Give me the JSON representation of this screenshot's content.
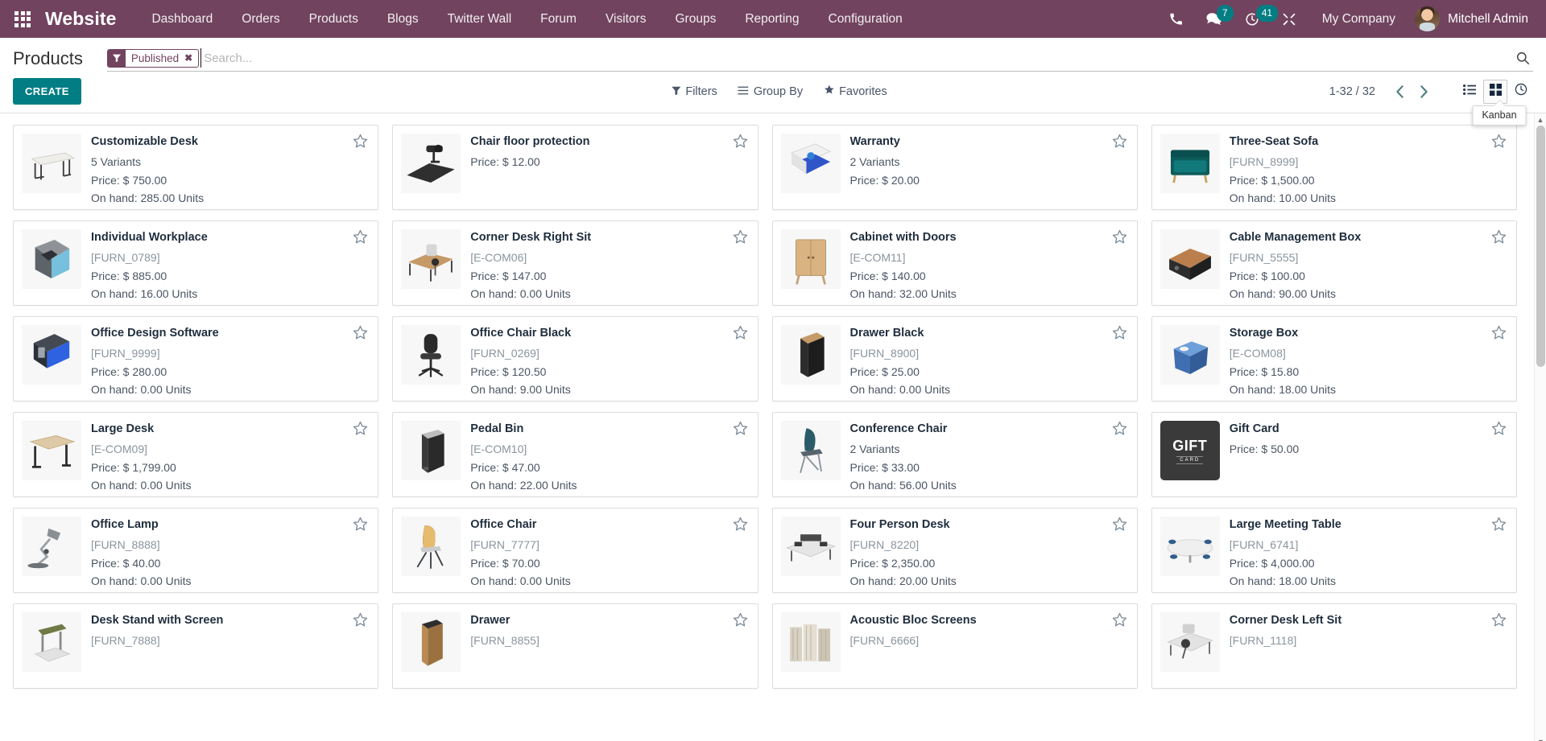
{
  "navbar": {
    "apps_icon": "apps-grid-icon",
    "brand": "Website",
    "menu": [
      {
        "label": "Dashboard"
      },
      {
        "label": "Orders"
      },
      {
        "label": "Products"
      },
      {
        "label": "Blogs"
      },
      {
        "label": "Twitter Wall"
      },
      {
        "label": "Forum"
      },
      {
        "label": "Visitors"
      },
      {
        "label": "Groups"
      },
      {
        "label": "Reporting"
      },
      {
        "label": "Configuration"
      }
    ],
    "icons": [
      {
        "name": "phone-icon",
        "badge": ""
      },
      {
        "name": "messages-icon",
        "badge": "7"
      },
      {
        "name": "activities-clock-icon",
        "badge": "41"
      },
      {
        "name": "debug-tools-icon",
        "badge": ""
      }
    ],
    "company": "My Company",
    "user": "Mitchell Admin",
    "avatar": "user-avatar",
    "bg_color": "#71435f",
    "badge_color": "#017e84"
  },
  "control_panel": {
    "title": "Products",
    "create_label": "CREATE",
    "search": {
      "facet_icon": "filter-funnel-icon",
      "facet_label": "Published",
      "facet_close": "✖",
      "value": "",
      "placeholder": "Search..."
    },
    "dropdowns": [
      {
        "name": "filters",
        "icon": "funnel-icon",
        "label": "Filters"
      },
      {
        "name": "group-by",
        "icon": "bars-icon",
        "label": "Group By"
      },
      {
        "name": "favorites",
        "icon": "star-icon",
        "label": "Favorites"
      }
    ],
    "pager": {
      "count": "1-32 / 32",
      "prev": "‹",
      "next": "›"
    },
    "views": [
      {
        "name": "list-view",
        "icon": "list-icon",
        "active": false
      },
      {
        "name": "kanban-view",
        "icon": "grid-icon",
        "active": true
      },
      {
        "name": "activity-view",
        "icon": "clock-icon",
        "active": false
      }
    ],
    "tooltip": "Kanban"
  },
  "products": [
    {
      "name": "Customizable Desk",
      "sub": "5 Variants",
      "sub_is_code": false,
      "price": "Price: $ 750.00",
      "onhand": "On hand: 285.00 Units",
      "image": "desk-white"
    },
    {
      "name": "Chair floor protection",
      "sub": "",
      "sub_is_code": false,
      "price": "Price: $ 12.00",
      "onhand": "",
      "image": "floor-mat"
    },
    {
      "name": "Warranty",
      "sub": "2 Variants",
      "sub_is_code": false,
      "price": "Price: $ 20.00",
      "onhand": "",
      "image": "warranty-doc"
    },
    {
      "name": "Three-Seat Sofa",
      "sub": "[FURN_8999]",
      "sub_is_code": true,
      "price": "Price: $ 1,500.00",
      "onhand": "On hand: 10.00 Units",
      "image": "sofa-teal"
    },
    {
      "name": "Individual Workplace",
      "sub": "[FURN_0789]",
      "sub_is_code": true,
      "price": "Price: $ 885.00",
      "onhand": "On hand: 16.00 Units",
      "image": "pod-workplace"
    },
    {
      "name": "Corner Desk Right Sit",
      "sub": "[E-COM06]",
      "sub_is_code": true,
      "price": "Price: $ 147.00",
      "onhand": "On hand: 0.00 Units",
      "image": "corner-desk"
    },
    {
      "name": "Cabinet with Doors",
      "sub": "[E-COM11]",
      "sub_is_code": true,
      "price": "Price: $ 140.00",
      "onhand": "On hand: 32.00 Units",
      "image": "cabinet-wood"
    },
    {
      "name": "Cable Management Box",
      "sub": "[FURN_5555]",
      "sub_is_code": true,
      "price": "Price: $ 100.00",
      "onhand": "On hand: 90.00 Units",
      "image": "cable-box"
    },
    {
      "name": "Office Design Software",
      "sub": "[FURN_9999]",
      "sub_is_code": true,
      "price": "Price: $ 280.00",
      "onhand": "On hand: 0.00 Units",
      "image": "software-box"
    },
    {
      "name": "Office Chair Black",
      "sub": "[FURN_0269]",
      "sub_is_code": true,
      "price": "Price: $ 120.50",
      "onhand": "On hand: 9.00 Units",
      "image": "chair-black"
    },
    {
      "name": "Drawer Black",
      "sub": "[FURN_8900]",
      "sub_is_code": true,
      "price": "Price: $ 25.00",
      "onhand": "On hand: 0.00 Units",
      "image": "drawer-black"
    },
    {
      "name": "Storage Box",
      "sub": "[E-COM08]",
      "sub_is_code": true,
      "price": "Price: $ 15.80",
      "onhand": "On hand: 18.00 Units",
      "image": "storage-blue"
    },
    {
      "name": "Large Desk",
      "sub": "[E-COM09]",
      "sub_is_code": true,
      "price": "Price: $ 1,799.00",
      "onhand": "On hand: 0.00 Units",
      "image": "large-desk"
    },
    {
      "name": "Pedal Bin",
      "sub": "[E-COM10]",
      "sub_is_code": true,
      "price": "Price: $ 47.00",
      "onhand": "On hand: 22.00 Units",
      "image": "pedal-bin"
    },
    {
      "name": "Conference Chair",
      "sub": "2 Variants",
      "sub_is_code": false,
      "price": "Price: $ 33.00",
      "onhand": "On hand: 56.00 Units",
      "image": "conference-chair"
    },
    {
      "name": "Gift Card",
      "sub": "",
      "sub_is_code": false,
      "price": "Price: $ 50.00",
      "onhand": "",
      "image": "gift-card"
    },
    {
      "name": "Office Lamp",
      "sub": "[FURN_8888]",
      "sub_is_code": true,
      "price": "Price: $ 40.00",
      "onhand": "On hand: 0.00 Units",
      "image": "lamp"
    },
    {
      "name": "Office Chair",
      "sub": "[FURN_7777]",
      "sub_is_code": true,
      "price": "Price: $ 70.00",
      "onhand": "On hand: 0.00 Units",
      "image": "chair-wood"
    },
    {
      "name": "Four Person Desk",
      "sub": "[FURN_8220]",
      "sub_is_code": true,
      "price": "Price: $ 2,350.00",
      "onhand": "On hand: 20.00 Units",
      "image": "four-person-desk"
    },
    {
      "name": "Large Meeting Table",
      "sub": "[FURN_6741]",
      "sub_is_code": true,
      "price": "Price: $ 4,000.00",
      "onhand": "On hand: 18.00 Units",
      "image": "meeting-table"
    },
    {
      "name": "Desk Stand with Screen",
      "sub": "[FURN_7888]",
      "sub_is_code": true,
      "price": "",
      "onhand": "",
      "image": "desk-stand"
    },
    {
      "name": "Drawer",
      "sub": "[FURN_8855]",
      "sub_is_code": true,
      "price": "",
      "onhand": "",
      "image": "drawer-wood"
    },
    {
      "name": "Acoustic Bloc Screens",
      "sub": "[FURN_6666]",
      "sub_is_code": true,
      "price": "",
      "onhand": "",
      "image": "acoustic-screens"
    },
    {
      "name": "Corner Desk Left Sit",
      "sub": "[FURN_1118]",
      "sub_is_code": true,
      "price": "",
      "onhand": "",
      "image": "corner-desk-left"
    }
  ]
}
